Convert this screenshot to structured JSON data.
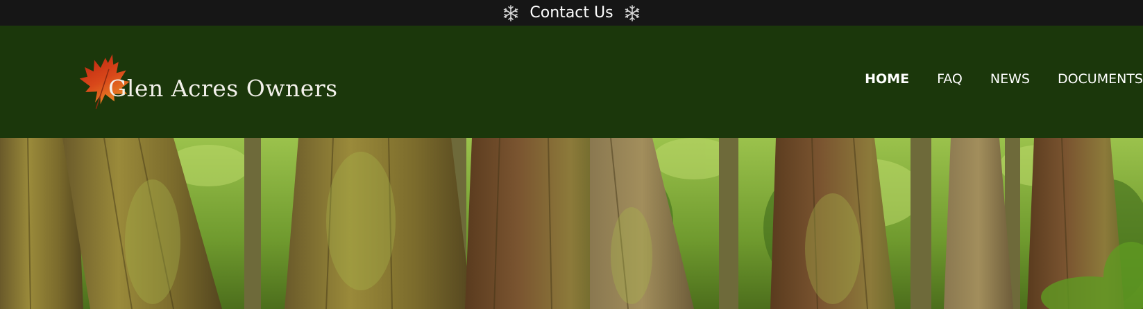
{
  "topbar": {
    "contact_label": "Contact Us",
    "left_icon": "snowflake-icon",
    "right_icon": "snowflake-icon"
  },
  "header": {
    "brand_name": "Glen Acres Owners",
    "logo_icon": "maple-leaf-icon"
  },
  "nav": {
    "items": [
      {
        "label": "HOME",
        "active": true
      },
      {
        "label": "FAQ",
        "active": false
      },
      {
        "label": "NEWS",
        "active": false
      },
      {
        "label": "DOCUMENTS",
        "active": false
      }
    ]
  },
  "colors": {
    "topbar_bg": "#161616",
    "header_bg": "#1b370b",
    "text": "#ffffff",
    "forest_green": "#7da436",
    "bark_brown": "#6b4a26"
  }
}
